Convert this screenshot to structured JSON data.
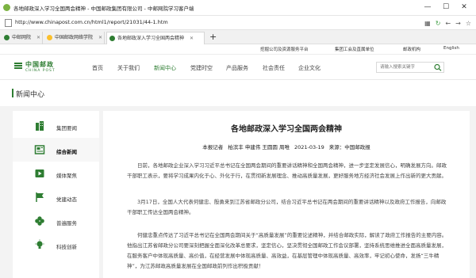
{
  "window": {
    "title": "各地邮政深入学习全国两会精神 - 中国邮政集团有限公司 - 中邮网院学习客户端",
    "minimize": "—",
    "maximize": "☐",
    "close": "✕"
  },
  "address": {
    "url": "http://www.chinapost.com.cn/html1/report/21031/44-1.htm"
  },
  "tabs": [
    {
      "label": "中邮网院"
    },
    {
      "label": "中国邮政网络学院"
    },
    {
      "label": "各地邮政深入学习全国两会精神"
    }
  ],
  "tab_new": "+",
  "topstrip": {
    "items": [
      "挖掘公司及资源服务平台",
      "集团工会及直属单位",
      "邮政机构",
      "English"
    ]
  },
  "logo": {
    "cn": "中国邮政",
    "en": "CHINA POST"
  },
  "nav": [
    {
      "label": "首页"
    },
    {
      "label": "关于我们"
    },
    {
      "label": "新闻中心"
    },
    {
      "label": "党建时空"
    },
    {
      "label": "产品服务"
    },
    {
      "label": "社会责任"
    },
    {
      "label": "企业文化"
    }
  ],
  "search": {
    "placeholder": "请输入搜索关键字"
  },
  "section_title": "新闻中心",
  "sidebar": {
    "items": [
      {
        "label": "集团要闻",
        "icon": "building-icon"
      },
      {
        "label": "综合新闻",
        "icon": "newspaper-icon"
      },
      {
        "label": "媒体聚焦",
        "icon": "video-icon"
      },
      {
        "label": "党建动态",
        "icon": "flag-icon"
      },
      {
        "label": "普遍服务",
        "icon": "clover-icon"
      },
      {
        "label": "科技创新",
        "icon": "bulb-icon"
      }
    ]
  },
  "article": {
    "title": "各地邮政深入学习全国两会精神",
    "reporter_label": "本报记者",
    "reporters": "柏滨丰 申建伟 王圆圆 周唯",
    "date": "2021-03-19",
    "source": "来源：中国邮政报",
    "paragraphs": [
      "日前，各地邮政企业深入学习习近平总书记在全国两会期间的重要讲话精神和全国两会精神，进一步坚定发展信心，明确发展方向。邮政干部职工表示，要将学习成果内化于心、外化于行，在贯彻新发展理念、推动高质量发展，更好服务地方经济社会发展上作出新的更大贡献。",
      "3月17日，全国人大代表何健忠、殷勇来到江苏省邮政分公司，结合习近平总书记在两会期间的重要讲话精神以及政府工作报告，向邮政干部职工传达全国两会精神。",
      "何健忠重点传达了习近平总书记在全国两会期间关于“高质量发展”的重要论述精神，并结合邮政实际，解读了政府工作报告的主要内容。他指出江苏省邮政分公司要深刻把握全面深化改革总要求，坚定信心，坚决贯彻全国邮政工作会议部署，坚持系统思维推进全面高质量发展，在服务客户中体现高质量、高价值，在经营发展中体现高质量、高效益，在基层管理中体现高质量、高效率，牢记初心使命，发扬“三牛精神”，为江苏邮政高质量发展在全国邮政前列作出积极贡献！"
    ]
  }
}
